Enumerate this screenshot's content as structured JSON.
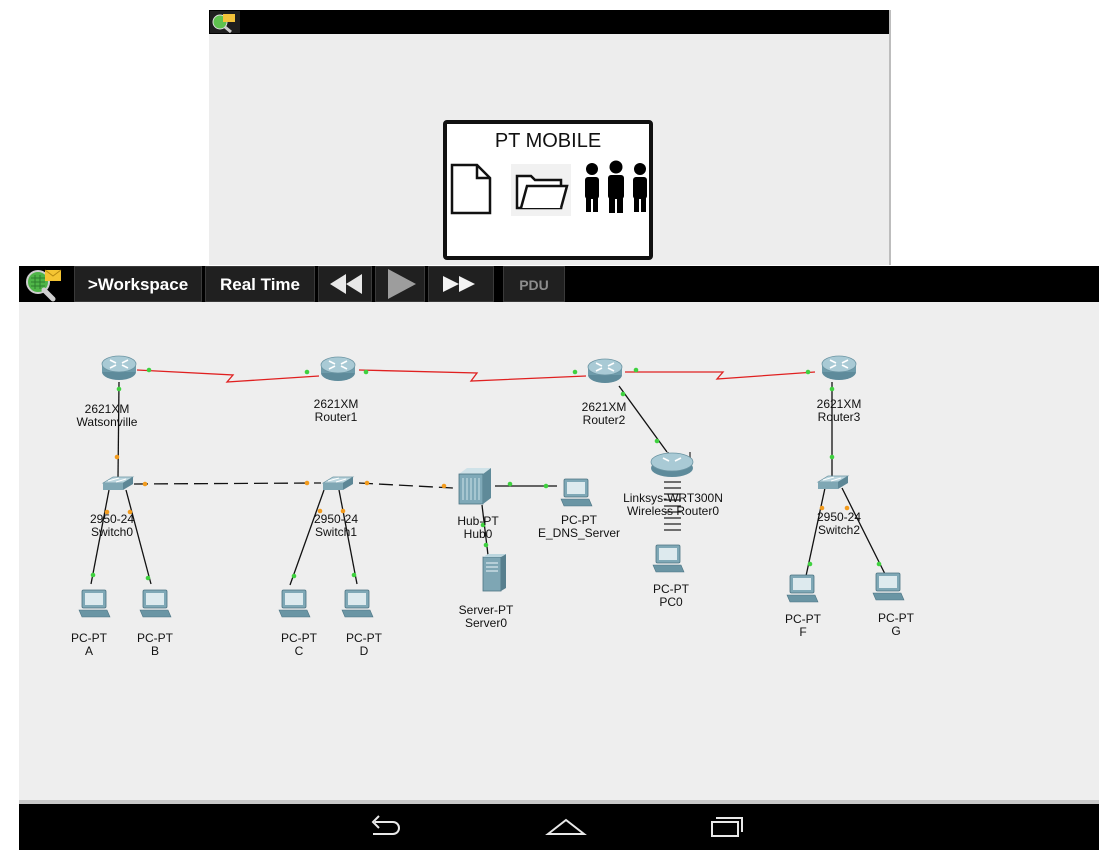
{
  "splash": {
    "title": "PT MOBILE",
    "icons": [
      "document-icon",
      "folder-icon",
      "users-icon"
    ]
  },
  "toolbar": {
    "workspace_label": ">Workspace",
    "realtime_label": "Real Time",
    "pdu_label": "PDU",
    "icons": [
      "rewind-icon",
      "play-icon",
      "fast-forward-icon"
    ]
  },
  "devices": {
    "watsonville": {
      "model": "2621XM",
      "name": "Watsonville"
    },
    "router1": {
      "model": "2621XM",
      "name": "Router1"
    },
    "router2": {
      "model": "2621XM",
      "name": "Router2"
    },
    "router3": {
      "model": "2621XM",
      "name": "Router3"
    },
    "switch0": {
      "model": "2950-24",
      "name": "Switch0"
    },
    "switch1": {
      "model": "2950-24",
      "name": "Switch1"
    },
    "switch2": {
      "model": "2950-24",
      "name": "Switch2"
    },
    "hub0": {
      "model": "Hub-PT",
      "name": "Hub0"
    },
    "server0": {
      "model": "Server-PT",
      "name": "Server0"
    },
    "dns": {
      "model": "PC-PT",
      "name": "E_DNS_Server"
    },
    "wireless": {
      "model": "Linksys-WRT300N",
      "name": "Wireless Router0"
    },
    "pc0": {
      "model": "PC-PT",
      "name": "PC0"
    },
    "pc_a": {
      "model": "PC-PT",
      "name": "A"
    },
    "pc_b": {
      "model": "PC-PT",
      "name": "B"
    },
    "pc_c": {
      "model": "PC-PT",
      "name": "C"
    },
    "pc_d": {
      "model": "PC-PT",
      "name": "D"
    },
    "pc_f": {
      "model": "PC-PT",
      "name": "F"
    },
    "pc_g": {
      "model": "PC-PT",
      "name": "G"
    }
  },
  "colors": {
    "serial_link": "#e02020",
    "copper_link": "#111111",
    "link_up": "#3fd13f",
    "link_amber": "#f29b1d",
    "router_body": "#7fa9b8",
    "toolbar_bg": "#000000",
    "canvas_bg": "#eeeeee"
  },
  "navbar": {
    "icons": [
      "back-icon",
      "home-icon",
      "recent-apps-icon"
    ]
  }
}
